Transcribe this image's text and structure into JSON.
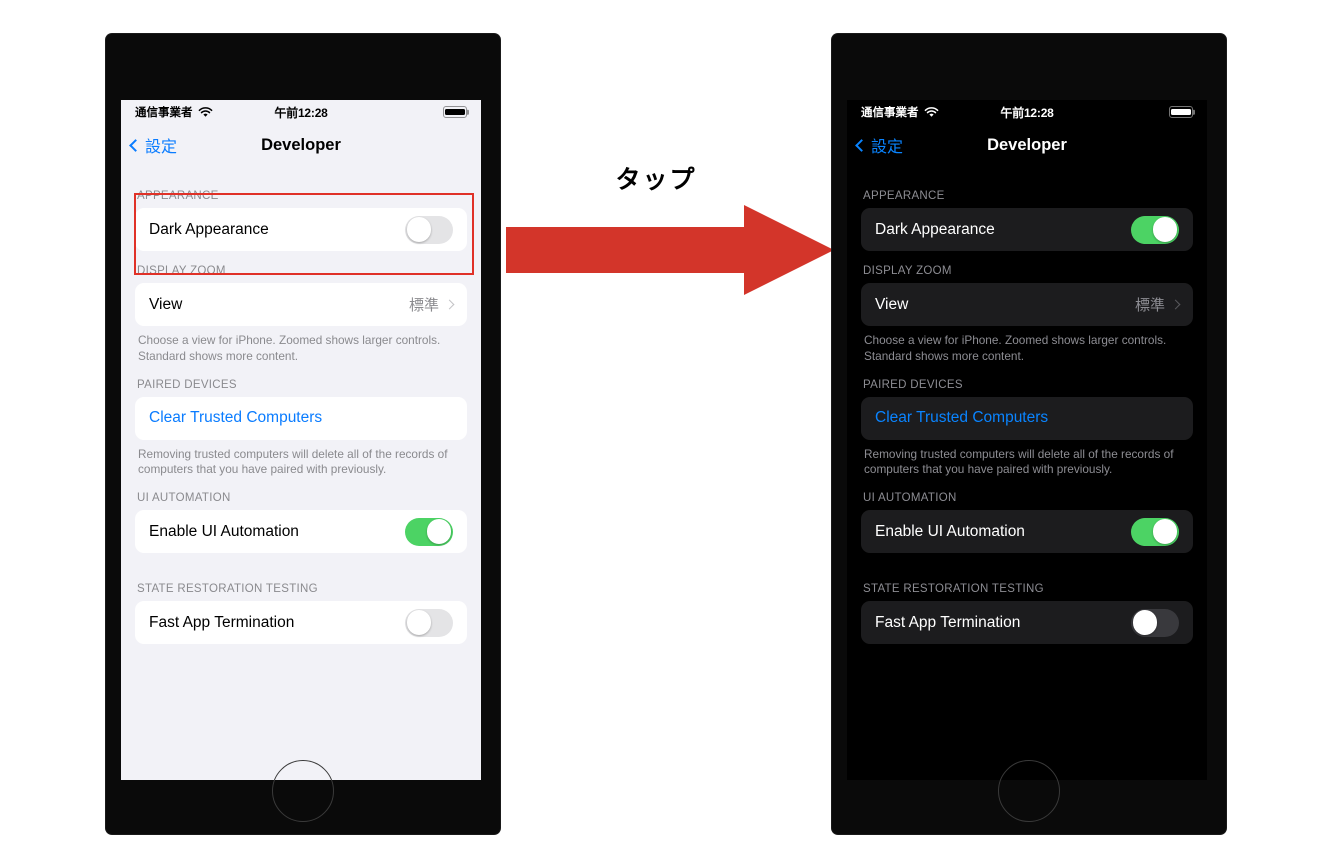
{
  "canvas": {
    "background": "#ffffff",
    "annotation_color": "#e03127"
  },
  "annotation": {
    "caption": "タップ",
    "arrow_name": "red-right-arrow",
    "highlight_target": "APPEARANCE section"
  },
  "status_bar": {
    "carrier": "通信事業者",
    "wifi": "wifi-icon",
    "time": "午前12:28",
    "battery": "battery-icon"
  },
  "nav": {
    "back_label": "設定",
    "title": "Developer"
  },
  "sections": {
    "appearance": {
      "header": "APPEARANCE",
      "row_label": "Dark Appearance",
      "before_state": "off",
      "after_state": "on"
    },
    "display_zoom": {
      "header": "DISPLAY ZOOM",
      "row_label": "View",
      "row_value": "標準",
      "footnote": "Choose a view for iPhone. Zoomed shows larger controls. Standard shows more content."
    },
    "paired_devices": {
      "header": "PAIRED DEVICES",
      "row_label": "Clear Trusted Computers",
      "footnote": "Removing trusted computers will delete all of the records of computers that you have paired with previously."
    },
    "ui_automation": {
      "header": "UI AUTOMATION",
      "row_label": "Enable UI Automation",
      "state": "on"
    },
    "state_restoration": {
      "header": "STATE RESTORATION TESTING",
      "row_label": "Fast App Termination",
      "state": "off"
    }
  },
  "colors": {
    "toggle_on": "#4cd364",
    "link_blue_light": "#0a7cff",
    "link_blue_dark": "#0a84ff",
    "light_bg": "#f2f2f7",
    "dark_bg": "#000000",
    "dark_group": "#1c1c1e"
  }
}
